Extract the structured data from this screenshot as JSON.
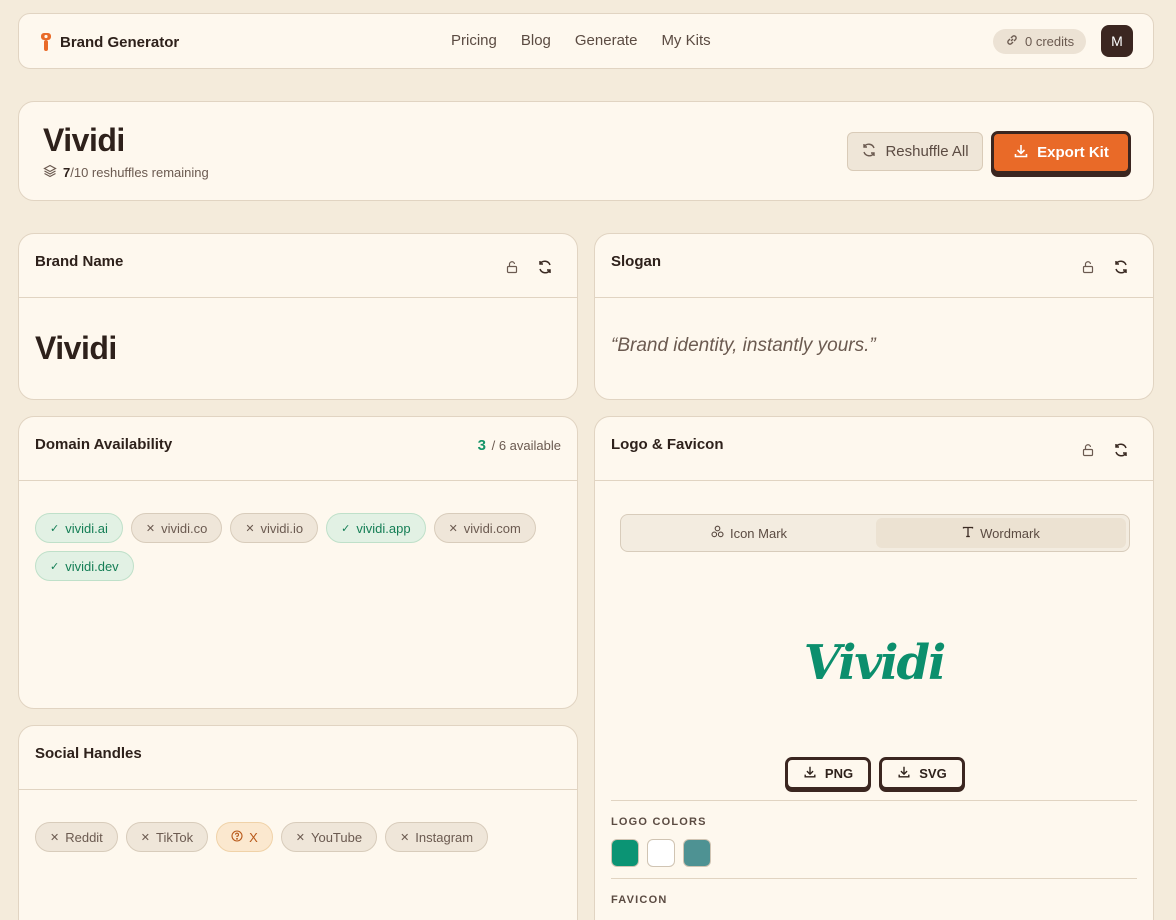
{
  "nav": {
    "brand": "Brand Generator",
    "links": [
      "Pricing",
      "Blog",
      "Generate",
      "My Kits"
    ],
    "credits": "0 credits",
    "avatar": "M"
  },
  "header": {
    "title": "Vividi",
    "reshuffles_used": "7",
    "reshuffles_rest": "/10 reshuffles remaining",
    "reshuffle_all": "Reshuffle All",
    "export": "Export Kit"
  },
  "brand_name": {
    "title": "Brand Name",
    "value": "Vividi"
  },
  "slogan": {
    "title": "Slogan",
    "value": "“Brand identity, instantly yours.”"
  },
  "domains": {
    "title": "Domain Availability",
    "available_count": "3",
    "available_rest": "/ 6 available",
    "items": [
      {
        "name": "vividi.ai",
        "status": "available"
      },
      {
        "name": "vividi.co",
        "status": "taken"
      },
      {
        "name": "vividi.io",
        "status": "taken"
      },
      {
        "name": "vividi.app",
        "status": "available"
      },
      {
        "name": "vividi.com",
        "status": "taken"
      },
      {
        "name": "vividi.dev",
        "status": "available"
      }
    ]
  },
  "social": {
    "title": "Social Handles",
    "items": [
      {
        "name": "Reddit",
        "status": "taken"
      },
      {
        "name": "TikTok",
        "status": "taken"
      },
      {
        "name": "X",
        "status": "unknown"
      },
      {
        "name": "YouTube",
        "status": "taken"
      },
      {
        "name": "Instagram",
        "status": "taken"
      }
    ]
  },
  "logo": {
    "title": "Logo & Favicon",
    "tab_icon": "Icon Mark",
    "tab_word": "Wordmark",
    "active_tab": "Wordmark",
    "wordmark": "Vividi",
    "png": "PNG",
    "svg": "SVG",
    "colors_label": "LOGO COLORS",
    "colors": [
      "#0b9474",
      "#ffffff",
      "#4e9293"
    ],
    "favicon_label": "FAVICON"
  },
  "theme": {
    "accent": "#e96a28",
    "dark": "#3b2620",
    "green": "#149468"
  }
}
